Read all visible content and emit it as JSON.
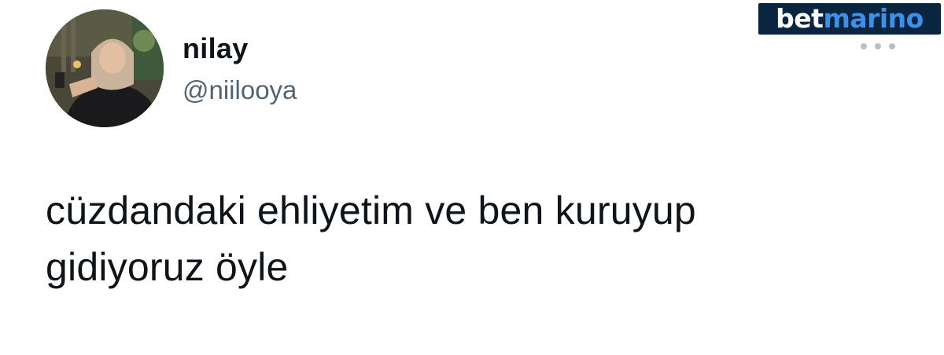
{
  "author": {
    "display_name": "nilay",
    "handle": "@niilooya",
    "avatar_icon": "profile-photo"
  },
  "brand": {
    "part_a": "bet",
    "part_b": "marino",
    "colors": {
      "background": "#0a2540",
      "part_a": "#ffffff",
      "part_b": "#3f8fe6"
    }
  },
  "menu": {
    "icon": "more-dots-icon"
  },
  "tweet": {
    "lines": [
      "cüzdandaki ehliyetim ve ben kuruyup",
      "gidiyoruz öyle"
    ]
  },
  "colors": {
    "text": "#0f1419",
    "secondary_text": "#536471"
  }
}
